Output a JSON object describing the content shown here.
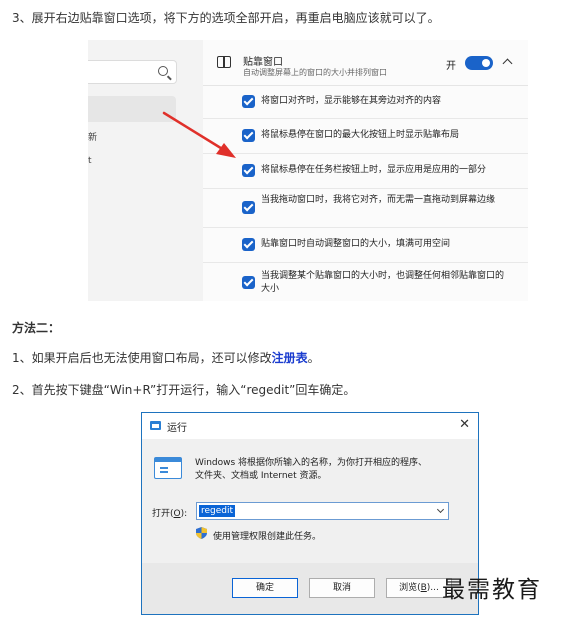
{
  "step3": "3、展开右边贴靠窗口选项，将下方的选项全部开启，再重启电脑应该就可以了。",
  "settings_shot": {
    "left_fragments": [
      "新",
      "t"
    ],
    "header_title": "贴靠窗口",
    "header_sub": "自动调整屏幕上的窗口的大小并排列窗口",
    "toggle_state": "开",
    "options": [
      "将窗口对齐时，显示能够在其旁边对齐的内容",
      "将鼠标悬停在窗口的最大化按钮上时显示贴靠布局",
      "将鼠标悬停在任务栏按钮上时，显示应用是应用的一部分",
      "当我拖动窗口时，我将它对齐，而无需一直拖动到屏幕边缘",
      "贴靠窗口时自动调整窗口的大小，填满可用空间",
      "当我调整某个贴靠窗口的大小时，也调整任何相邻贴靠窗口的大小"
    ],
    "arrow_color": "#e0302a",
    "accent": "#1a63c9"
  },
  "method2_heading": "方法二：",
  "step1_pre": "1、如果开启后也无法使用窗口布局，还可以修改",
  "step1_link": "注册表",
  "step1_post": "。",
  "step2": "2、首先按下键盘“Win+R”打开运行，输入“regedit”回车确定。",
  "run_dialog": {
    "title": "运行",
    "desc_line1": "Windows 将根据你所输入的名称，为你打开相应的程序、",
    "desc_line2": "文件夹、文档或 Internet 资源。",
    "open_label_pre": "打开(",
    "open_label_key": "O",
    "open_label_post": "):",
    "input_value": "regedit",
    "admin_note": "使用管理权限创建此任务。",
    "ok": "确定",
    "cancel": "取消",
    "browse_pre": "浏览(",
    "browse_key": "B",
    "browse_post": ")..."
  },
  "watermark": "最需教育"
}
